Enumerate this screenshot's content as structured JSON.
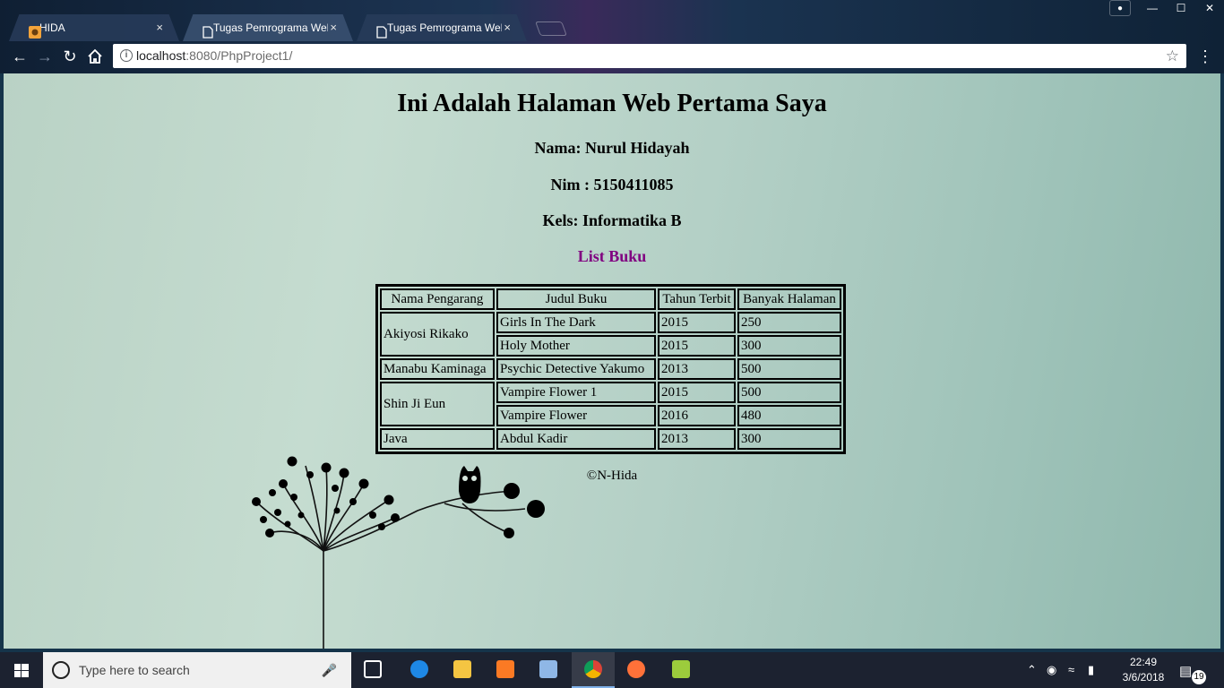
{
  "browser": {
    "tabs": [
      {
        "title": "HIDA",
        "close": "×"
      },
      {
        "title": "Tugas Pemrograma Web",
        "close": "×"
      },
      {
        "title": "Tugas Pemrograma Web",
        "close": "×"
      }
    ],
    "address_host": "localhost",
    "address_rest": ":8080/PhpProject1/",
    "window_controls": {
      "minimize": "—",
      "maximize": "☐",
      "close": "✕"
    }
  },
  "page": {
    "title": "Ini Adalah Halaman Web Pertama Saya",
    "nama": "Nama: Nurul Hidayah",
    "nim": "Nim : 5150411085",
    "kelas": "Kels: Informatika B",
    "list_heading": "List Buku",
    "footer": "©N-Hida",
    "table": {
      "headers": [
        "Nama Pengarang",
        "Judul Buku",
        "Tahun Terbit",
        "Banyak Halaman"
      ],
      "groups": [
        {
          "author": "Akiyosi Rikako",
          "rows": [
            {
              "judul": "Girls In The Dark",
              "tahun": "2015",
              "halaman": "250"
            },
            {
              "judul": "Holy Mother",
              "tahun": "2015",
              "halaman": "300"
            }
          ]
        },
        {
          "author": "Manabu Kaminaga",
          "rows": [
            {
              "judul": "Psychic Detective Yakumo",
              "tahun": "2013",
              "halaman": "500"
            }
          ]
        },
        {
          "author": "Shin Ji Eun",
          "rows": [
            {
              "judul": "Vampire Flower 1",
              "tahun": "2015",
              "halaman": "500"
            },
            {
              "judul": "Vampire Flower",
              "tahun": "2016",
              "halaman": "480"
            }
          ]
        },
        {
          "author": "Java",
          "rows": [
            {
              "judul": "Abdul Kadir",
              "tahun": "2013",
              "halaman": "300"
            }
          ]
        }
      ]
    }
  },
  "taskbar": {
    "search_placeholder": "Type here to search",
    "time": "22:49",
    "date": "3/6/2018",
    "notification_count": "19"
  },
  "colors": {
    "list_heading": "#800080",
    "taskbar": "#1c2230"
  }
}
